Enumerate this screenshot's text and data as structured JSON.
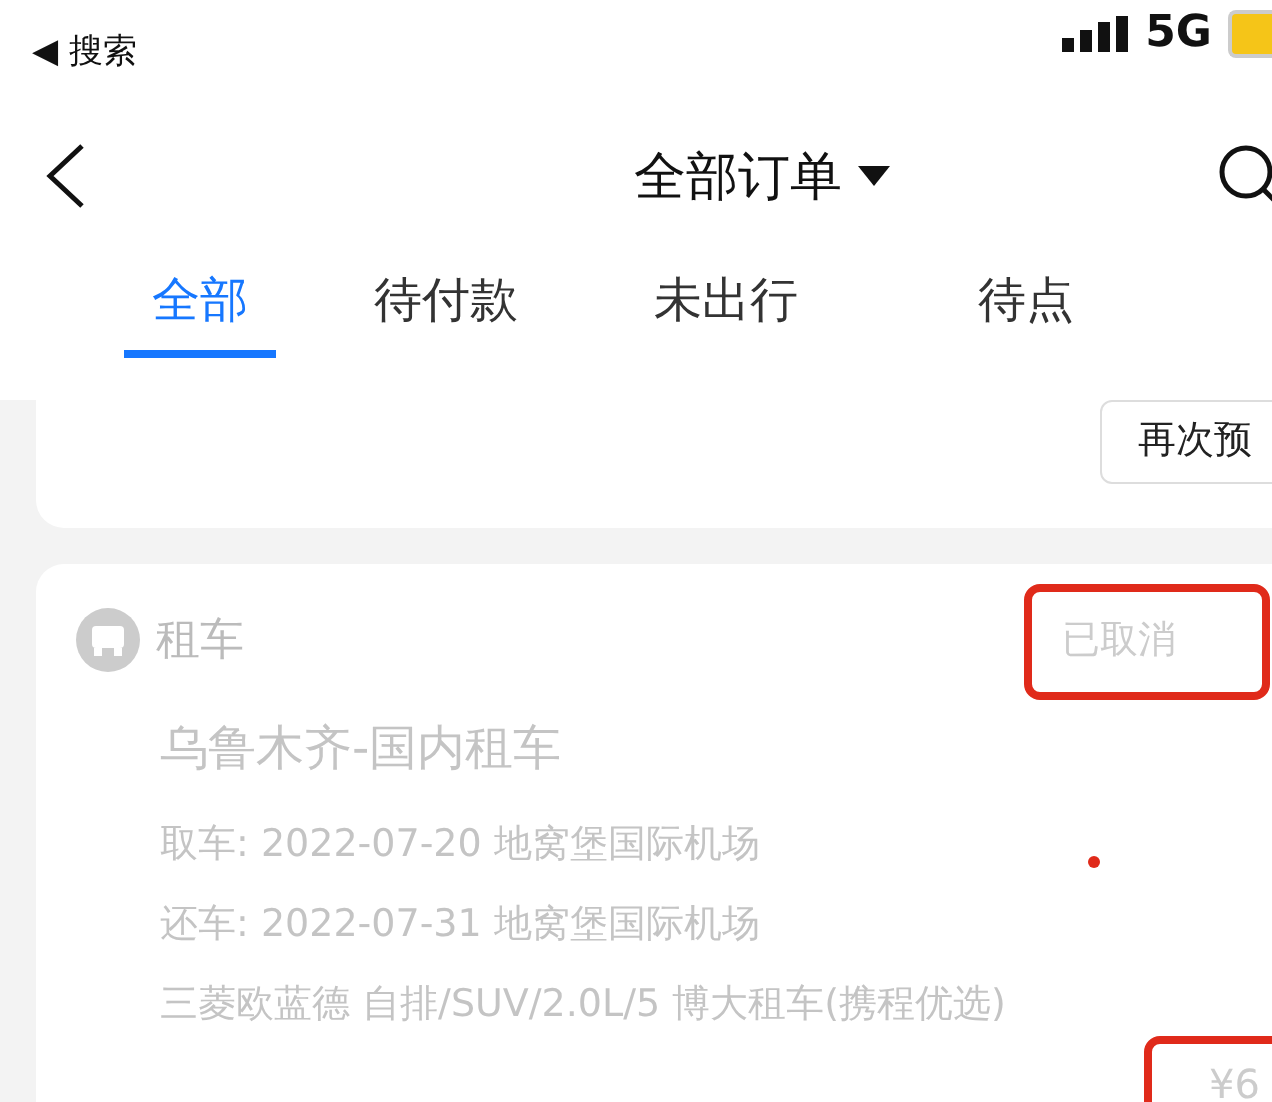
{
  "status_bar": {
    "back_label": "◀ 搜索",
    "network": "5G"
  },
  "nav": {
    "title": "全部订单"
  },
  "tabs": [
    {
      "label": "全部",
      "selected": true
    },
    {
      "label": "待付款",
      "selected": false
    },
    {
      "label": "未出行",
      "selected": false
    },
    {
      "label": "待点",
      "selected": false
    }
  ],
  "previous_order": {
    "button": "再次预"
  },
  "order": {
    "category": "租车",
    "status": "已取消",
    "status_marked": true,
    "title": "乌鲁木齐-国内租车",
    "details": [
      "取车: 2022-07-20 地窝堡国际机场",
      "还车: 2022-07-31 地窝堡国际机场",
      "三菱欧蓝德 自排/SUV/2.0L/5 博大租车(携程优选)"
    ],
    "price": "¥6",
    "price_marked": true
  }
}
